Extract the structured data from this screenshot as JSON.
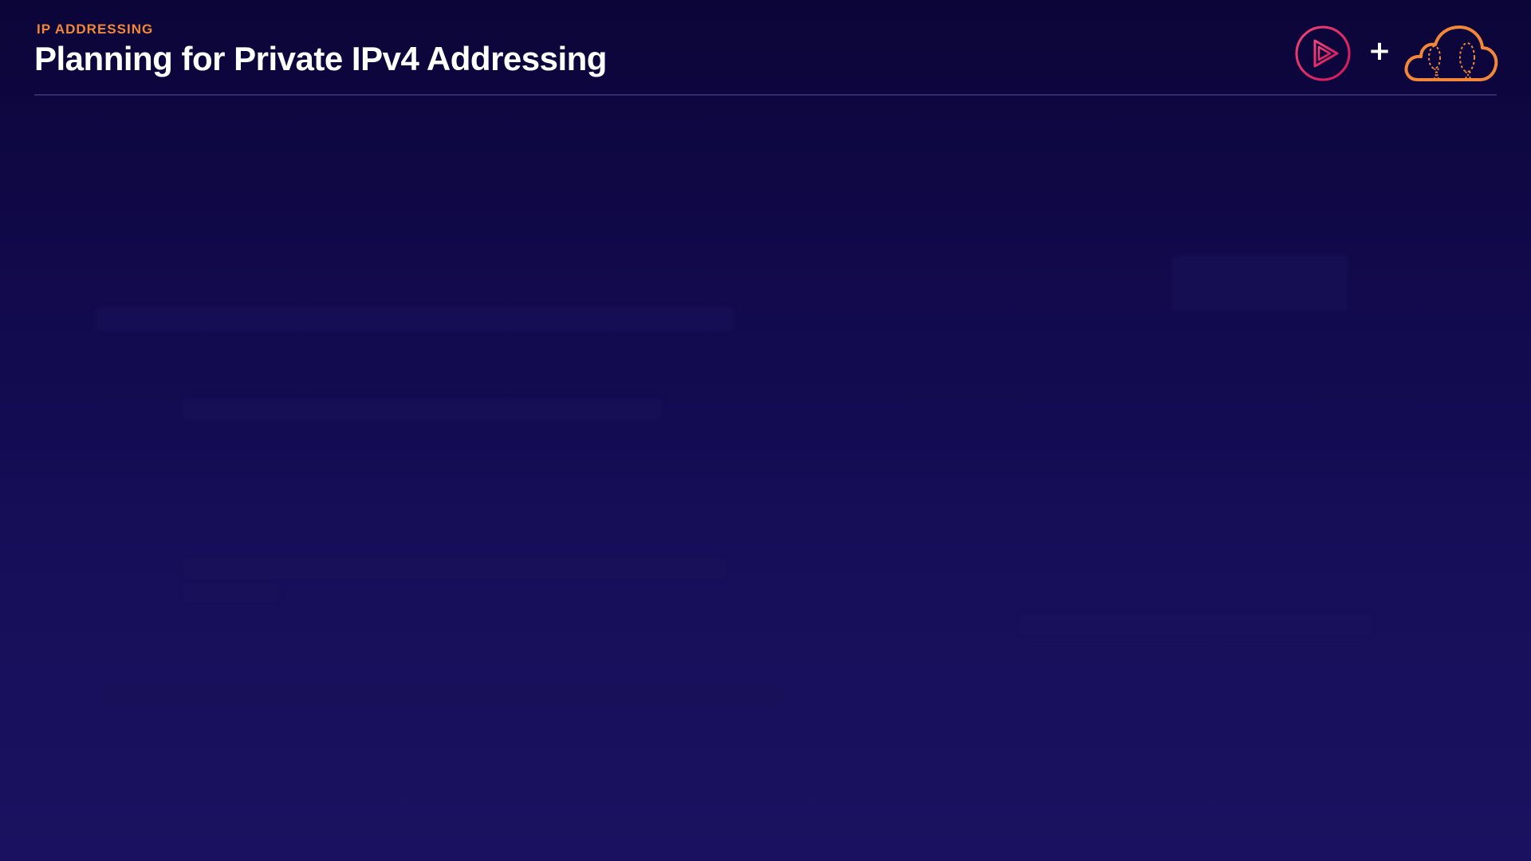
{
  "header": {
    "eyebrow": "IP ADDRESSING",
    "title": "Planning for Private IPv4 Addressing"
  },
  "logos": {
    "left_icon": "play-circle-icon",
    "separator": "+",
    "right_icon": "cloud-icon"
  },
  "colors": {
    "background_top": "#0b0538",
    "background_bottom": "#1a1260",
    "accent_orange": "#f2873a",
    "accent_pink": "#e0245e",
    "title_text": "#ffffff"
  }
}
